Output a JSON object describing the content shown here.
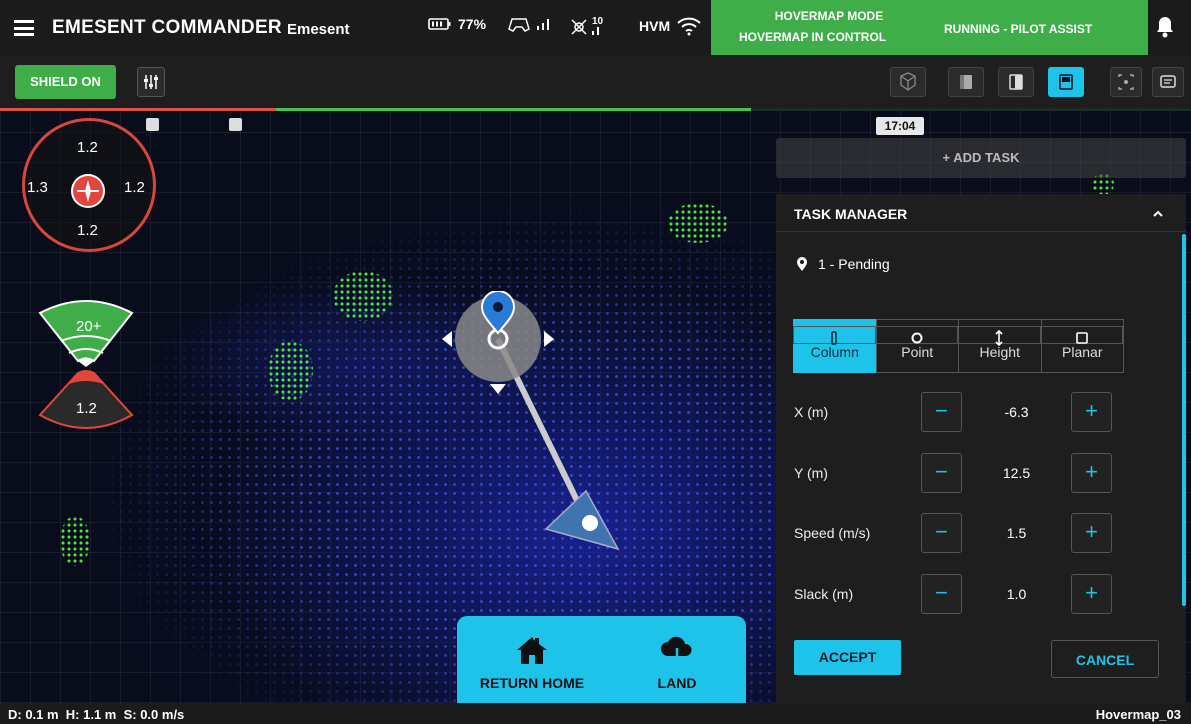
{
  "header": {
    "title": "EMESENT COMMANDER",
    "org": "Emesent",
    "battery": "77%",
    "controller_icon": "gamepad-icon",
    "drone_signal": "10",
    "hvm_label": "HVM",
    "mode_line1": "HOVERMAP MODE",
    "mode_line2": "HOVERMAP IN CONTROL",
    "run_status": "RUNNING - PILOT ASSIST",
    "mode_color": "#3fae49"
  },
  "toolbar": {
    "shield_label": "SHIELD ON",
    "view_buttons": [
      "perspective-view-icon",
      "cube-view-icon",
      "side-view-icon",
      "top-view-icon",
      "recenter-icon",
      "chat-icon"
    ],
    "active_view": "top-view-icon",
    "accent": "#1ec3ea"
  },
  "overlay": {
    "clock": "17:04",
    "add_task": "+ ADD TASK",
    "compass": {
      "top": "1.2",
      "left": "1.3",
      "right": "1.2",
      "bottom": "1.2"
    },
    "clearance_up": "20+",
    "clearance_down": "1.2"
  },
  "task_manager": {
    "title": "TASK MANAGER",
    "task_status": "1 - Pending",
    "types": [
      "Column",
      "Point",
      "Height",
      "Planar"
    ],
    "active_type": "Column",
    "fields": [
      {
        "label": "X (m)",
        "value": "-6.3"
      },
      {
        "label": "Y (m)",
        "value": "12.5"
      },
      {
        "label": "Speed (m/s)",
        "value": "1.5"
      },
      {
        "label": "Slack (m)",
        "value": "1.0"
      }
    ],
    "accept": "ACCEPT",
    "cancel": "CANCEL"
  },
  "actions": {
    "return_home": "RETURN HOME",
    "land": "LAND"
  },
  "status": {
    "left": "D: 0.1 m  H: 1.1 m  S: 0.0 m/s",
    "right": "Hovermap_03"
  }
}
